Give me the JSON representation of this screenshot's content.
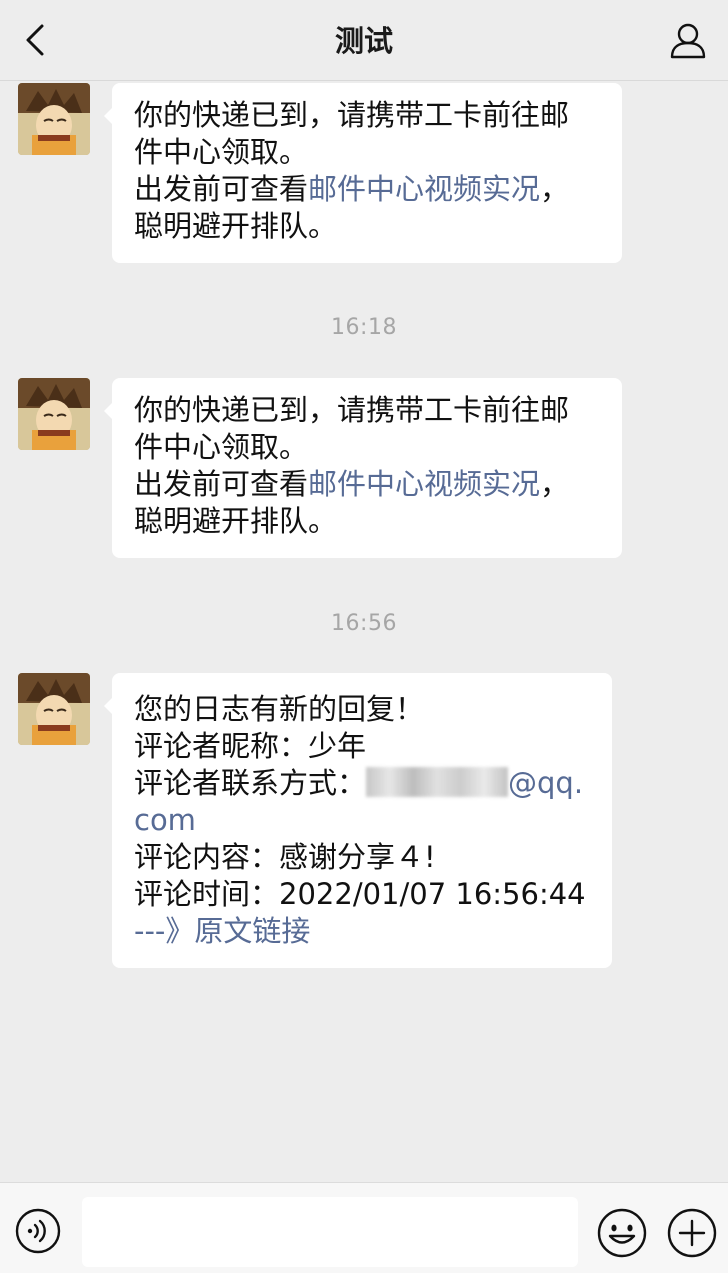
{
  "header": {
    "title": "测试",
    "back_icon": "chevron-left-icon",
    "profile_icon": "person-icon"
  },
  "messages": [
    {
      "line1": "你的快递已到，请携带工卡前往邮",
      "line2": "件中心领取。",
      "line3_prefix": "出发前可查看",
      "line3_link": "邮件中心视频实况",
      "line3_suffix": "，",
      "line4": "聪明避开排队。"
    },
    {
      "line1": "你的快递已到，请携带工卡前往邮",
      "line2": "件中心领取。",
      "line3_prefix": "出发前可查看",
      "line3_link": "邮件中心视频实况",
      "line3_suffix": "，",
      "line4": "聪明避开排队。"
    },
    {
      "title": "您的日志有新的回复！",
      "nickname_label": "评论者昵称：",
      "nickname": "少年",
      "contact_label": "评论者联系方式：",
      "contact_email_visible": "@qq.",
      "contact_email_line2": "com",
      "content_label": "评论内容：",
      "content": "感谢分享４!",
      "time_label": "评论时间：",
      "time": "2022/01/07 16:56:44",
      "link": "---》原文链接"
    }
  ],
  "timestamps": [
    "16:18",
    "16:56"
  ],
  "input_bar": {
    "voice_icon": "voice-icon",
    "input_value": "",
    "emoji_icon": "emoji-icon",
    "plus_icon": "plus-icon"
  },
  "colors": {
    "background": "#ededed",
    "bubble": "#ffffff",
    "link": "#576b95",
    "timestamp": "#a6a6a6"
  }
}
